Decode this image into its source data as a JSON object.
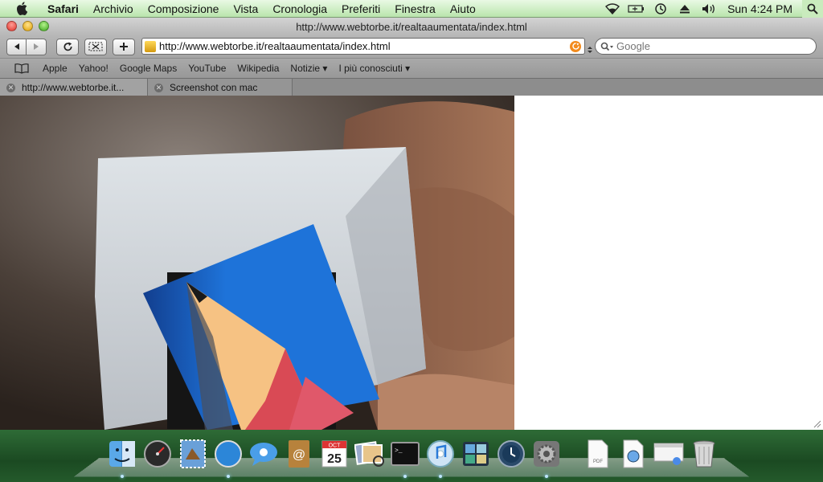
{
  "menubar": {
    "app_name": "Safari",
    "items": [
      "Archivio",
      "Composizione",
      "Vista",
      "Cronologia",
      "Preferiti",
      "Finestra",
      "Aiuto"
    ],
    "clock": "Sun 4:24 PM"
  },
  "window": {
    "title": "http://www.webtorbe.it/realtaaumentata/index.html"
  },
  "toolbar": {
    "url": "http://www.webtorbe.it/realtaaumentata/index.html",
    "search_placeholder": "Google"
  },
  "bookmarks": [
    "Apple",
    "Yahoo!",
    "Google Maps",
    "YouTube",
    "Wikipedia",
    "Notizie ▾",
    "I più conosciuti ▾"
  ],
  "tabs": [
    {
      "label": "http://www.webtorbe.it..."
    },
    {
      "label": "Screenshot con mac"
    }
  ],
  "dock": {
    "calendar_date": "25",
    "calendar_month": "OCT",
    "icons": [
      "finder-icon",
      "dashboard-icon",
      "mail-stamp-icon",
      "safari-icon",
      "ichat-icon",
      "address-book-icon",
      "ical-icon",
      "iphoto-icon",
      "terminal-icon",
      "itunes-icon",
      "spaces-icon",
      "time-machine-icon",
      "system-preferences-icon",
      "pdf-document-icon",
      "preview-document-icon",
      "installer-icon",
      "trash-icon"
    ]
  },
  "colors": {
    "menubar_top": "#e9f9e4",
    "menubar_bottom": "#b9e5ac",
    "dock_bg": "#245a2b",
    "ar_blue": "#1e73d9",
    "pencil_wood": "#f6c283",
    "pencil_red": "#d94a55"
  }
}
